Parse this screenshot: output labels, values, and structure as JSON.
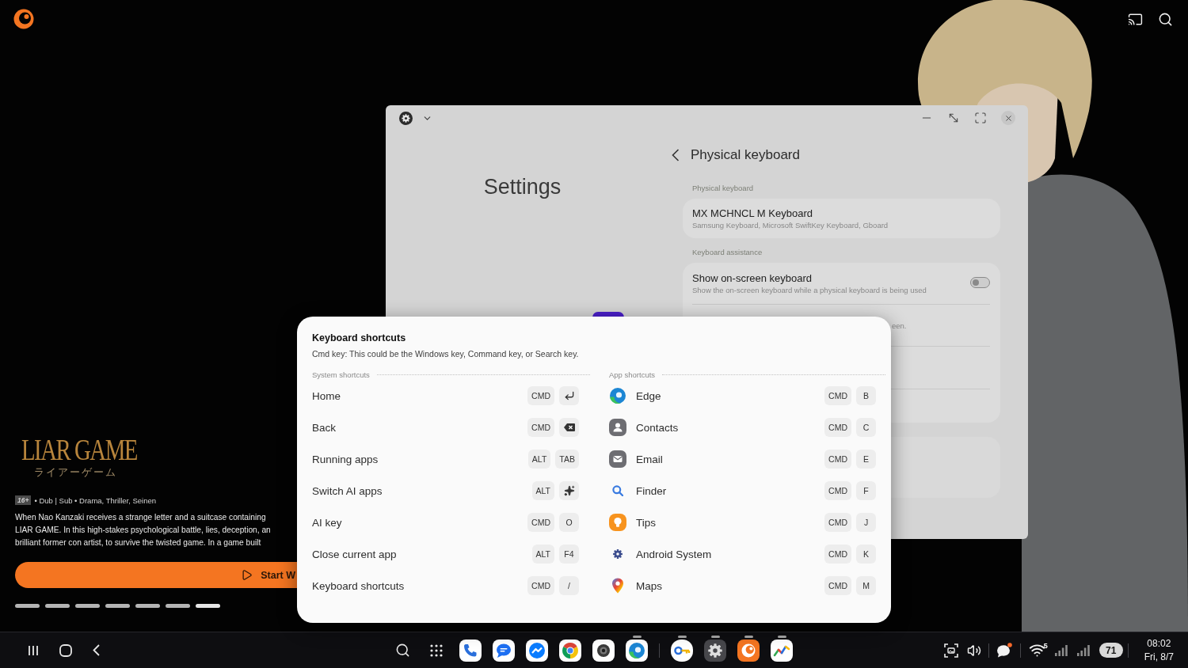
{
  "hero": {
    "logo_title": "LIAR GAME",
    "logo_subtitle": "ライアーゲーム",
    "rating": "16+",
    "meta": "• Dub | Sub • Drama, Thriller, Seinen",
    "description_lines": [
      "When Nao Kanzaki receives a strange letter and a suitcase containing",
      "LIAR GAME. In this high-stakes psychological battle, lies, deception, an",
      "brilliant former con artist, to survive the twisted game. In a game built"
    ],
    "play_button": "Start W",
    "carousel": [
      {
        "selected": false
      },
      {
        "selected": false
      },
      {
        "selected": false
      },
      {
        "selected": false
      },
      {
        "selected": false
      },
      {
        "selected": false
      },
      {
        "selected": true
      }
    ]
  },
  "settings_window": {
    "sidebar_title": "Settings",
    "page_title": "Physical keyboard",
    "sections": [
      {
        "header": "Physical keyboard",
        "items": [
          {
            "kind": "info",
            "title": "MX MCHNCL M Keyboard",
            "subtitle": "Samsung Keyboard, Microsoft SwiftKey Keyboard, Gboard"
          }
        ]
      },
      {
        "header": "Keyboard assistance",
        "items": [
          {
            "kind": "toggle",
            "title": "Show on-screen keyboard",
            "subtitle": "Show the on-screen keyboard while a physical keyboard is being used",
            "on": false
          },
          {
            "kind": "covered",
            "text": "een."
          }
        ]
      }
    ]
  },
  "shortcuts_dialog": {
    "title": "Keyboard shortcuts",
    "note": "Cmd key: This could be the Windows key, Command key, or Search key.",
    "groups": [
      {
        "kind": "system",
        "header": "System shortcuts",
        "rows": [
          {
            "label": "Home",
            "keys": [
              {
                "kind": "text",
                "label": "CMD"
              },
              {
                "kind": "enter"
              }
            ]
          },
          {
            "label": "Back",
            "keys": [
              {
                "kind": "text",
                "label": "CMD"
              },
              {
                "kind": "backspace"
              }
            ]
          },
          {
            "label": "Running apps",
            "keys": [
              {
                "kind": "text",
                "label": "ALT"
              },
              {
                "kind": "text",
                "label": "TAB"
              }
            ]
          },
          {
            "label": "Switch AI apps",
            "keys": [
              {
                "kind": "text",
                "label": "ALT"
              },
              {
                "kind": "sparkle"
              }
            ]
          },
          {
            "label": "AI key",
            "keys": [
              {
                "kind": "text",
                "label": "CMD"
              },
              {
                "kind": "text",
                "label": "O"
              }
            ]
          },
          {
            "label": "Close current app",
            "keys": [
              {
                "kind": "text",
                "label": "ALT"
              },
              {
                "kind": "text",
                "label": "F4"
              }
            ]
          },
          {
            "label": "Keyboard shortcuts",
            "keys": [
              {
                "kind": "text",
                "label": "CMD"
              },
              {
                "kind": "text",
                "label": "/"
              }
            ]
          }
        ]
      },
      {
        "kind": "apps",
        "header": "App shortcuts",
        "rows": [
          {
            "label": "Edge",
            "keys": [
              {
                "kind": "text",
                "label": "CMD"
              },
              {
                "kind": "text",
                "label": "B"
              }
            ]
          },
          {
            "label": "Contacts",
            "keys": [
              {
                "kind": "text",
                "label": "CMD"
              },
              {
                "kind": "text",
                "label": "C"
              }
            ]
          },
          {
            "label": "Email",
            "keys": [
              {
                "kind": "text",
                "label": "CMD"
              },
              {
                "kind": "text",
                "label": "E"
              }
            ]
          },
          {
            "label": "Finder",
            "keys": [
              {
                "kind": "text",
                "label": "CMD"
              },
              {
                "kind": "text",
                "label": "F"
              }
            ]
          },
          {
            "label": "Tips",
            "keys": [
              {
                "kind": "text",
                "label": "CMD"
              },
              {
                "kind": "text",
                "label": "J"
              }
            ]
          },
          {
            "label": "Android System",
            "keys": [
              {
                "kind": "text",
                "label": "CMD"
              },
              {
                "kind": "text",
                "label": "K"
              }
            ]
          },
          {
            "label": "Maps",
            "keys": [
              {
                "kind": "text",
                "label": "CMD"
              },
              {
                "kind": "text",
                "label": "M"
              }
            ]
          }
        ]
      }
    ]
  },
  "taskbar": {
    "pinned_apps": [
      {
        "running": false
      },
      {
        "running": false
      },
      {
        "running": false
      },
      {
        "running": false
      },
      {
        "running": false
      },
      {
        "running": true
      }
    ],
    "recent_apps": [
      {
        "running": true
      },
      {
        "running": true
      },
      {
        "running": true
      },
      {
        "running": true
      }
    ],
    "status": {
      "unread": true,
      "network": "5",
      "battery": "71",
      "time": "08:02",
      "date": "Fri, 8/7"
    }
  }
}
